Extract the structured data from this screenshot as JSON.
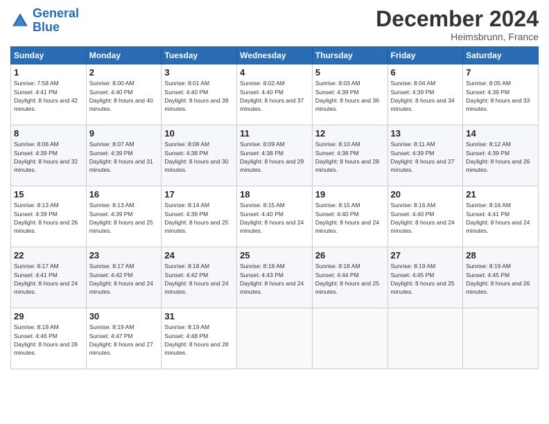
{
  "header": {
    "logo_line1": "General",
    "logo_line2": "Blue",
    "title": "December 2024",
    "subtitle": "Heimsbrunn, France"
  },
  "calendar": {
    "weekdays": [
      "Sunday",
      "Monday",
      "Tuesday",
      "Wednesday",
      "Thursday",
      "Friday",
      "Saturday"
    ],
    "weeks": [
      [
        {
          "day": "1",
          "rise": "7:58 AM",
          "set": "4:41 PM",
          "daylight": "8 hours and 42 minutes."
        },
        {
          "day": "2",
          "rise": "8:00 AM",
          "set": "4:40 PM",
          "daylight": "8 hours and 40 minutes."
        },
        {
          "day": "3",
          "rise": "8:01 AM",
          "set": "4:40 PM",
          "daylight": "8 hours and 39 minutes."
        },
        {
          "day": "4",
          "rise": "8:02 AM",
          "set": "4:40 PM",
          "daylight": "8 hours and 37 minutes."
        },
        {
          "day": "5",
          "rise": "8:03 AM",
          "set": "4:39 PM",
          "daylight": "8 hours and 36 minutes."
        },
        {
          "day": "6",
          "rise": "8:04 AM",
          "set": "4:39 PM",
          "daylight": "8 hours and 34 minutes."
        },
        {
          "day": "7",
          "rise": "8:05 AM",
          "set": "4:39 PM",
          "daylight": "8 hours and 33 minutes."
        }
      ],
      [
        {
          "day": "8",
          "rise": "8:06 AM",
          "set": "4:39 PM",
          "daylight": "8 hours and 32 minutes."
        },
        {
          "day": "9",
          "rise": "8:07 AM",
          "set": "4:39 PM",
          "daylight": "8 hours and 31 minutes."
        },
        {
          "day": "10",
          "rise": "8:08 AM",
          "set": "4:38 PM",
          "daylight": "8 hours and 30 minutes."
        },
        {
          "day": "11",
          "rise": "8:09 AM",
          "set": "4:38 PM",
          "daylight": "8 hours and 29 minutes."
        },
        {
          "day": "12",
          "rise": "8:10 AM",
          "set": "4:38 PM",
          "daylight": "8 hours and 28 minutes."
        },
        {
          "day": "13",
          "rise": "8:11 AM",
          "set": "4:39 PM",
          "daylight": "8 hours and 27 minutes."
        },
        {
          "day": "14",
          "rise": "8:12 AM",
          "set": "4:39 PM",
          "daylight": "8 hours and 26 minutes."
        }
      ],
      [
        {
          "day": "15",
          "rise": "8:13 AM",
          "set": "4:39 PM",
          "daylight": "8 hours and 26 minutes."
        },
        {
          "day": "16",
          "rise": "8:13 AM",
          "set": "4:39 PM",
          "daylight": "8 hours and 25 minutes."
        },
        {
          "day": "17",
          "rise": "8:14 AM",
          "set": "4:39 PM",
          "daylight": "8 hours and 25 minutes."
        },
        {
          "day": "18",
          "rise": "8:15 AM",
          "set": "4:40 PM",
          "daylight": "8 hours and 24 minutes."
        },
        {
          "day": "19",
          "rise": "8:15 AM",
          "set": "4:40 PM",
          "daylight": "8 hours and 24 minutes."
        },
        {
          "day": "20",
          "rise": "8:16 AM",
          "set": "4:40 PM",
          "daylight": "8 hours and 24 minutes."
        },
        {
          "day": "21",
          "rise": "8:16 AM",
          "set": "4:41 PM",
          "daylight": "8 hours and 24 minutes."
        }
      ],
      [
        {
          "day": "22",
          "rise": "8:17 AM",
          "set": "4:41 PM",
          "daylight": "8 hours and 24 minutes."
        },
        {
          "day": "23",
          "rise": "8:17 AM",
          "set": "4:42 PM",
          "daylight": "8 hours and 24 minutes."
        },
        {
          "day": "24",
          "rise": "8:18 AM",
          "set": "4:42 PM",
          "daylight": "8 hours and 24 minutes."
        },
        {
          "day": "25",
          "rise": "8:18 AM",
          "set": "4:43 PM",
          "daylight": "8 hours and 24 minutes."
        },
        {
          "day": "26",
          "rise": "8:18 AM",
          "set": "4:44 PM",
          "daylight": "8 hours and 25 minutes."
        },
        {
          "day": "27",
          "rise": "8:19 AM",
          "set": "4:45 PM",
          "daylight": "8 hours and 25 minutes."
        },
        {
          "day": "28",
          "rise": "8:19 AM",
          "set": "4:45 PM",
          "daylight": "8 hours and 26 minutes."
        }
      ],
      [
        {
          "day": "29",
          "rise": "8:19 AM",
          "set": "4:46 PM",
          "daylight": "8 hours and 26 minutes."
        },
        {
          "day": "30",
          "rise": "8:19 AM",
          "set": "4:47 PM",
          "daylight": "8 hours and 27 minutes."
        },
        {
          "day": "31",
          "rise": "8:19 AM",
          "set": "4:48 PM",
          "daylight": "8 hours and 28 minutes."
        },
        null,
        null,
        null,
        null
      ]
    ]
  }
}
